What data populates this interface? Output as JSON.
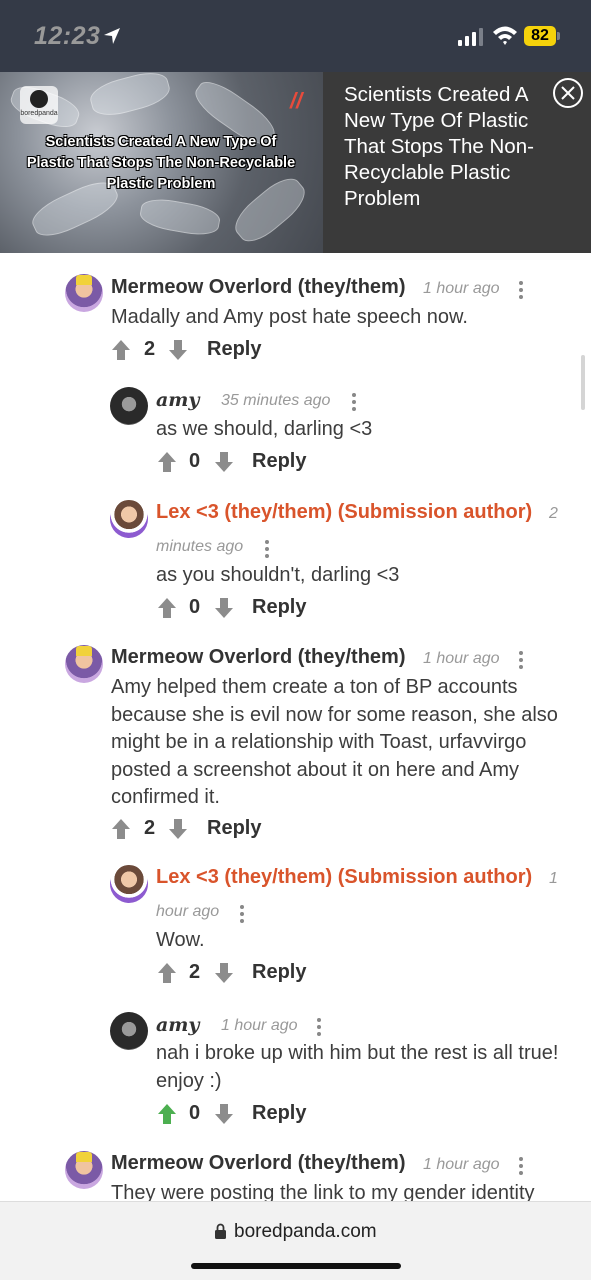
{
  "status_bar": {
    "time": "12:23",
    "battery": "82"
  },
  "ad": {
    "image_caption": "Scientists Created A New Type Of Plastic That Stops The Non-Recyclable Plastic Problem",
    "logo_text": "boredpanda",
    "title": "Scientists Created A New Type Of Plastic That Stops The Non-Recyclable Plastic Problem"
  },
  "comments": [
    {
      "author": "Mermeow Overlord (they/them)",
      "time": "1 hour ago",
      "text": "Madally and Amy post hate speech now.",
      "votes": "2",
      "reply": "Reply"
    },
    {
      "author": "amy",
      "time": "35 minutes ago",
      "text": "as we should, darling <3",
      "votes": "0",
      "reply": "Reply"
    },
    {
      "author": "Lex <3 (they/them) (Submission author)",
      "time_line1": "2",
      "time_line2": "minutes ago",
      "text": "as you shouldn't, darling <3",
      "votes": "0",
      "reply": "Reply"
    },
    {
      "author": "Mermeow Overlord (they/them)",
      "time": "1 hour ago",
      "text": "Amy helped them create a ton of BP accounts because she is evil now for some reason, she also might be in a relationship with Toast, urfavvirgo posted a screenshot about it on here and Amy confirmed it.",
      "votes": "2",
      "reply": "Reply"
    },
    {
      "author": "Lex <3 (they/them) (Submission author)",
      "time_line1": "1",
      "time_line2": "hour ago",
      "text": "Wow.",
      "votes": "2",
      "reply": "Reply"
    },
    {
      "author": "amy",
      "time": "1 hour ago",
      "text": "nah i broke up with him but the rest is all true! enjoy :)",
      "votes": "0",
      "reply": "Reply",
      "upvoted": true
    },
    {
      "author": "Mermeow Overlord (they/them)",
      "time": "1 hour ago",
      "text": "They were posting the link to my gender identity"
    }
  ],
  "url_bar": {
    "url": "boredpanda.com"
  },
  "colors": {
    "author": "#d9542b",
    "upvote_active": "#4caf50",
    "vote_icon": "#8c8c8c"
  }
}
